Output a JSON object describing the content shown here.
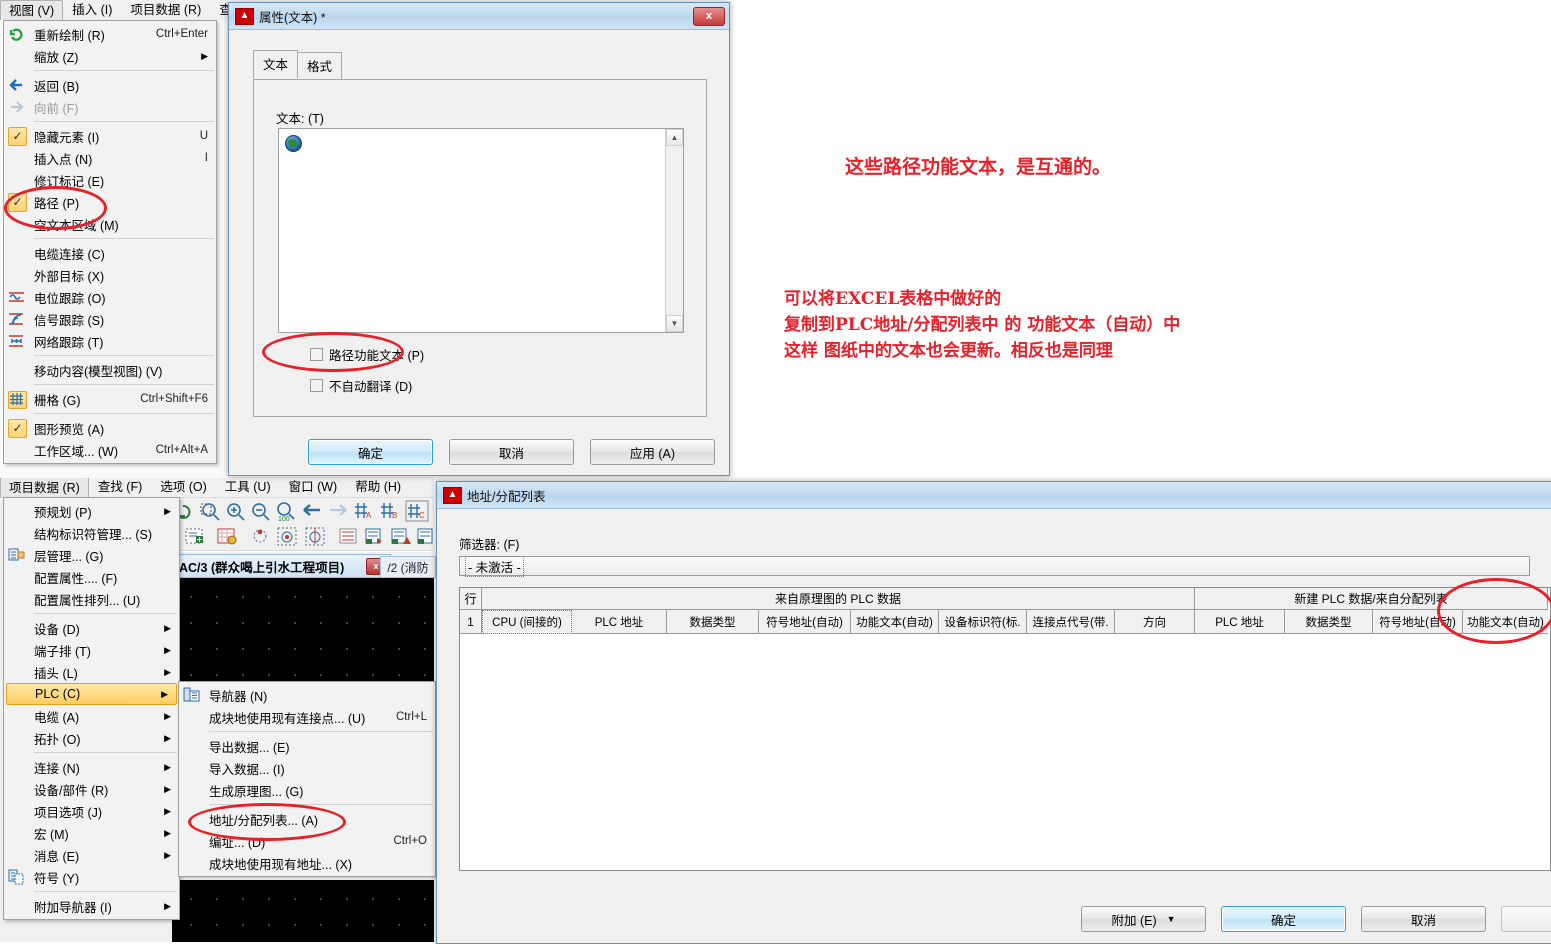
{
  "app": {
    "menubar_top": [
      {
        "label": "视图 (V)",
        "active": true
      },
      {
        "label": "插入 (I)",
        "active": false
      },
      {
        "label": "项目数据 (R)",
        "active": false
      },
      {
        "label": "查找",
        "active": false
      }
    ],
    "menubar_second": [
      {
        "label": "项目数据 (R)",
        "active": true
      },
      {
        "label": "查找 (F)",
        "active": false
      },
      {
        "label": "选项 (O)",
        "active": false
      },
      {
        "label": "工具 (U)",
        "active": false
      },
      {
        "label": "窗口 (W)",
        "active": false
      },
      {
        "label": "帮助 (H)",
        "active": false
      }
    ],
    "document_tab_active": "AC/3 (群众喝上引水工程项目)",
    "document_tab_close": "x",
    "document_tab_next": "/2 (消防"
  },
  "view_menu": {
    "items": [
      {
        "label": "重新绘制 (R)",
        "accel": "Ctrl+Enter",
        "icon": "refresh-icon",
        "checked": false,
        "arrow": false,
        "disabled": false
      },
      {
        "label": "缩放 (Z)",
        "accel": "",
        "icon": "",
        "checked": false,
        "arrow": true,
        "disabled": false
      },
      {
        "sep": true
      },
      {
        "label": "返回 (B)",
        "accel": "",
        "icon": "arrow-left-icon",
        "checked": false,
        "arrow": false,
        "disabled": false
      },
      {
        "label": "向前 (F)",
        "accel": "",
        "icon": "arrow-right-icon",
        "checked": false,
        "arrow": false,
        "disabled": true
      },
      {
        "sep": true
      },
      {
        "label": "隐藏元素 (I)",
        "accel": "U",
        "icon": "",
        "checked": true,
        "arrow": false,
        "disabled": false
      },
      {
        "label": "插入点 (N)",
        "accel": "I",
        "icon": "",
        "checked": false,
        "arrow": false,
        "disabled": false
      },
      {
        "label": "修订标记 (E)",
        "accel": "",
        "icon": "",
        "checked": false,
        "arrow": false,
        "disabled": false
      },
      {
        "label": "路径 (P)",
        "accel": "",
        "icon": "",
        "checked": true,
        "arrow": false,
        "disabled": false
      },
      {
        "label": "空文本区域 (M)",
        "accel": "",
        "icon": "",
        "checked": false,
        "arrow": false,
        "disabled": false
      },
      {
        "sep": true
      },
      {
        "label": "电缆连接 (C)",
        "accel": "",
        "icon": "",
        "checked": false,
        "arrow": false,
        "disabled": false
      },
      {
        "label": "外部目标 (X)",
        "accel": "",
        "icon": "",
        "checked": false,
        "arrow": false,
        "disabled": false
      },
      {
        "label": "电位跟踪 (O)",
        "accel": "",
        "icon": "potential-trace-icon",
        "checked": false,
        "arrow": false,
        "disabled": false
      },
      {
        "label": "信号跟踪 (S)",
        "accel": "",
        "icon": "signal-trace-icon",
        "checked": false,
        "arrow": false,
        "disabled": false
      },
      {
        "label": "网络跟踪 (T)",
        "accel": "",
        "icon": "network-trace-icon",
        "checked": false,
        "arrow": false,
        "disabled": false
      },
      {
        "sep": true
      },
      {
        "label": "移动内容(模型视图) (V)",
        "accel": "",
        "icon": "",
        "checked": false,
        "arrow": false,
        "disabled": false
      },
      {
        "sep": true
      },
      {
        "label": "栅格 (G)",
        "accel": "Ctrl+Shift+F6",
        "icon": "grid-icon",
        "checked": false,
        "arrow": false,
        "disabled": false
      },
      {
        "sep": true
      },
      {
        "label": "图形预览 (A)",
        "accel": "",
        "icon": "",
        "checked": true,
        "arrow": false,
        "disabled": false
      },
      {
        "label": "工作区域... (W)",
        "accel": "Ctrl+Alt+A",
        "icon": "",
        "checked": false,
        "arrow": false,
        "disabled": false
      }
    ]
  },
  "project_data_menu": {
    "items": [
      {
        "label": "预规划 (P)",
        "icon": "",
        "arrow": true,
        "selected": false
      },
      {
        "label": "结构标识符管理... (S)",
        "icon": "",
        "arrow": false,
        "selected": false
      },
      {
        "label": "层管理... (G)",
        "icon": "layer-icon",
        "arrow": false,
        "selected": false
      },
      {
        "label": "配置属性.... (F)",
        "icon": "",
        "arrow": false,
        "selected": false
      },
      {
        "label": "配置属性排列... (U)",
        "icon": "",
        "arrow": false,
        "selected": false
      },
      {
        "sep": true
      },
      {
        "label": "设备 (D)",
        "icon": "",
        "arrow": true,
        "selected": false
      },
      {
        "label": "端子排 (T)",
        "icon": "",
        "arrow": true,
        "selected": false
      },
      {
        "label": "插头 (L)",
        "icon": "",
        "arrow": true,
        "selected": false
      },
      {
        "label": "PLC (C)",
        "icon": "",
        "arrow": true,
        "selected": true
      },
      {
        "label": "电缆 (A)",
        "icon": "",
        "arrow": true,
        "selected": false
      },
      {
        "label": "拓扑 (O)",
        "icon": "",
        "arrow": true,
        "selected": false
      },
      {
        "sep": true
      },
      {
        "label": "连接 (N)",
        "icon": "",
        "arrow": true,
        "selected": false
      },
      {
        "label": "设备/部件 (R)",
        "icon": "",
        "arrow": true,
        "selected": false
      },
      {
        "label": "项目选项 (J)",
        "icon": "",
        "arrow": true,
        "selected": false
      },
      {
        "label": "宏 (M)",
        "icon": "",
        "arrow": true,
        "selected": false
      },
      {
        "label": "消息 (E)",
        "icon": "",
        "arrow": true,
        "selected": false
      },
      {
        "label": "符号 (Y)",
        "icon": "symbol-icon",
        "arrow": false,
        "selected": false
      },
      {
        "sep": true
      },
      {
        "label": "附加导航器 (I)",
        "icon": "",
        "arrow": true,
        "selected": false
      }
    ]
  },
  "plc_submenu": {
    "items": [
      {
        "label": "导航器 (N)",
        "accel": "",
        "icon": "plc-navigator-icon"
      },
      {
        "label": "成块地使用现有连接点... (U)",
        "accel": "Ctrl+L",
        "icon": ""
      },
      {
        "sep": true
      },
      {
        "label": "导出数据... (E)",
        "accel": "",
        "icon": ""
      },
      {
        "label": "导入数据... (I)",
        "accel": "",
        "icon": ""
      },
      {
        "label": "生成原理图... (G)",
        "accel": "",
        "icon": ""
      },
      {
        "sep": true
      },
      {
        "label": "地址/分配列表... (A)",
        "accel": "",
        "icon": ""
      },
      {
        "label": "编址... (D)",
        "accel": "Ctrl+O",
        "icon": ""
      },
      {
        "label": "成块地使用现有地址... (X)",
        "accel": "",
        "icon": ""
      }
    ]
  },
  "properties_dialog": {
    "title": "属性(文本) *",
    "close_label": "x",
    "tabs": [
      {
        "label": "文本",
        "active": true
      },
      {
        "label": "格式",
        "active": false
      }
    ],
    "text_field_label": "文本: (T)",
    "text_field_value": "",
    "checkboxes": [
      {
        "label": "路径功能文本 (P)",
        "checked": false
      },
      {
        "label": "不自动翻译 (D)",
        "checked": false
      }
    ],
    "buttons": [
      {
        "label": "确定",
        "primary": true
      },
      {
        "label": "取消",
        "primary": false
      },
      {
        "label": "应用 (A)",
        "primary": false
      }
    ]
  },
  "address_dialog": {
    "title": "地址/分配列表",
    "filter_label": "筛选器: (F)",
    "filter_value": "- 未激活 -",
    "table": {
      "row_header": "行",
      "group_headers": [
        {
          "label": "来自原理图的 PLC 数据"
        },
        {
          "label": "新建 PLC 数据/来自分配列表"
        }
      ],
      "columns_left": [
        "CPU (间接的)",
        "PLC 地址",
        "数据类型",
        "符号地址(自动)",
        "功能文本(自动)",
        "设备标识符(标.",
        "连接点代号(带.",
        "方向"
      ],
      "columns_right": [
        "PLC 地址",
        "数据类型",
        "符号地址(自动)",
        "功能文本(自动)"
      ],
      "row_numbers": [
        "1"
      ],
      "rows": []
    },
    "buttons": [
      {
        "label": "附加 (E)",
        "type": "split",
        "primary": false,
        "disabled": false
      },
      {
        "label": "确定",
        "type": "push",
        "primary": true,
        "disabled": false
      },
      {
        "label": "取消",
        "type": "push",
        "primary": false,
        "disabled": false
      },
      {
        "label": "应",
        "type": "push",
        "primary": false,
        "disabled": true
      }
    ]
  },
  "annotations": {
    "color": "#e8202a",
    "note1": "这些路径功能文本，是互通的。",
    "note2_lines": [
      "可以将EXCEL表格中做好的",
      "复制到PLC地址/分配列表中  的  功能文本（自动）中",
      "这样  图纸中的文本也会更新。相反也是同理"
    ]
  }
}
